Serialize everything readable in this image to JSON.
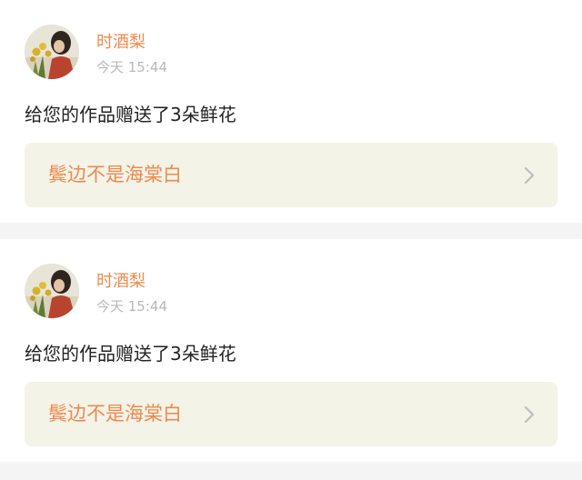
{
  "feed": {
    "items": [
      {
        "user": {
          "name": "时酒梨",
          "avatar_icon": "avatar-photo-icon"
        },
        "time": "今天 15:44",
        "message": "给您的作品赠送了3朵鲜花",
        "work": {
          "title": "鬓边不是海棠白",
          "icon": "chevron-right-icon"
        }
      },
      {
        "user": {
          "name": "时酒梨",
          "avatar_icon": "avatar-photo-icon"
        },
        "time": "今天 15:44",
        "message": "给您的作品赠送了3朵鲜花",
        "work": {
          "title": "鬓边不是海棠白",
          "icon": "chevron-right-icon"
        }
      }
    ]
  },
  "colors": {
    "page_background": "#f4f4f4",
    "card_background": "#ffffff",
    "accent": "#ef8a4c",
    "timestamp": "#b8b8b8",
    "link_background": "#f3f3e8",
    "chevron": "#bdbdbd"
  }
}
